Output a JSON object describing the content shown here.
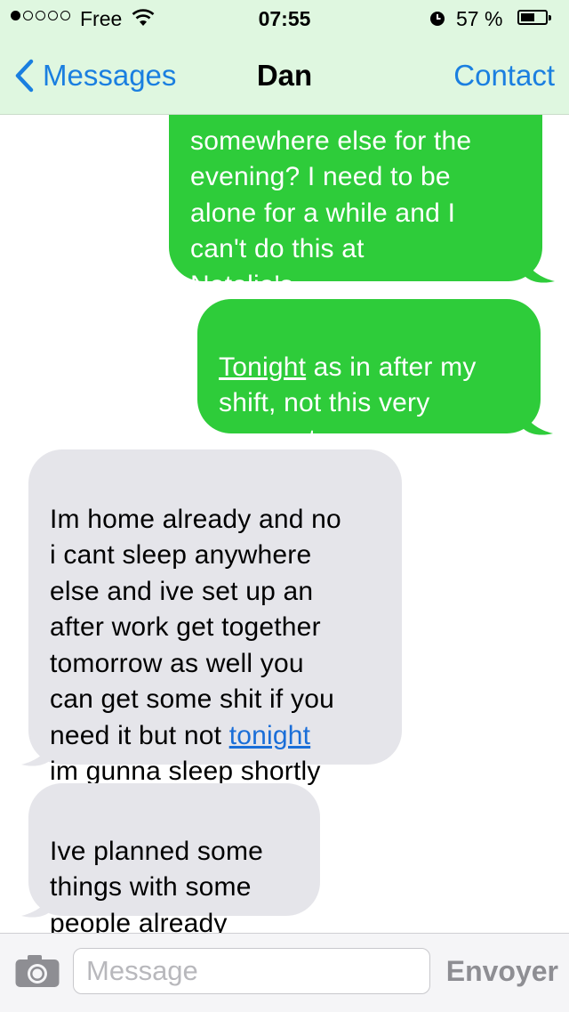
{
  "status_bar": {
    "carrier": "Free",
    "time": "07:55",
    "battery_percent": "57 %",
    "signal_bars_filled": 1,
    "signal_bars_total": 5,
    "battery_level": 0.57
  },
  "nav": {
    "back_label": "Messages",
    "title": "Dan",
    "contact_label": "Contact"
  },
  "messages": [
    {
      "from": "me",
      "text_clipped_top": "somewhere else for the",
      "text": "evening?  I need to be\nalone for a while and I\ncan't do this at\nNatalia's."
    },
    {
      "from": "me",
      "link": "Tonight",
      "text": " as in after my\nshift, not this very\nmoment."
    },
    {
      "from": "them",
      "text": "Im home already and no\ni cant sleep anywhere\nelse and ive set up an\nafter work get together\ntomorrow as well you\ncan get some shit if you\nneed it but not ",
      "link": "tonight",
      "text_after": "\nim gunna sleep shortly"
    },
    {
      "from": "them",
      "text": "Ive planned some\nthings with some\npeople already"
    }
  ],
  "composer": {
    "placeholder": "Message",
    "send_label": "Envoyer"
  },
  "colors": {
    "outgoing_bubble": "#2ecc3a",
    "incoming_bubble": "#e5e5ea",
    "accent": "#1a7fe0",
    "nav_background": "#dff7e0"
  }
}
